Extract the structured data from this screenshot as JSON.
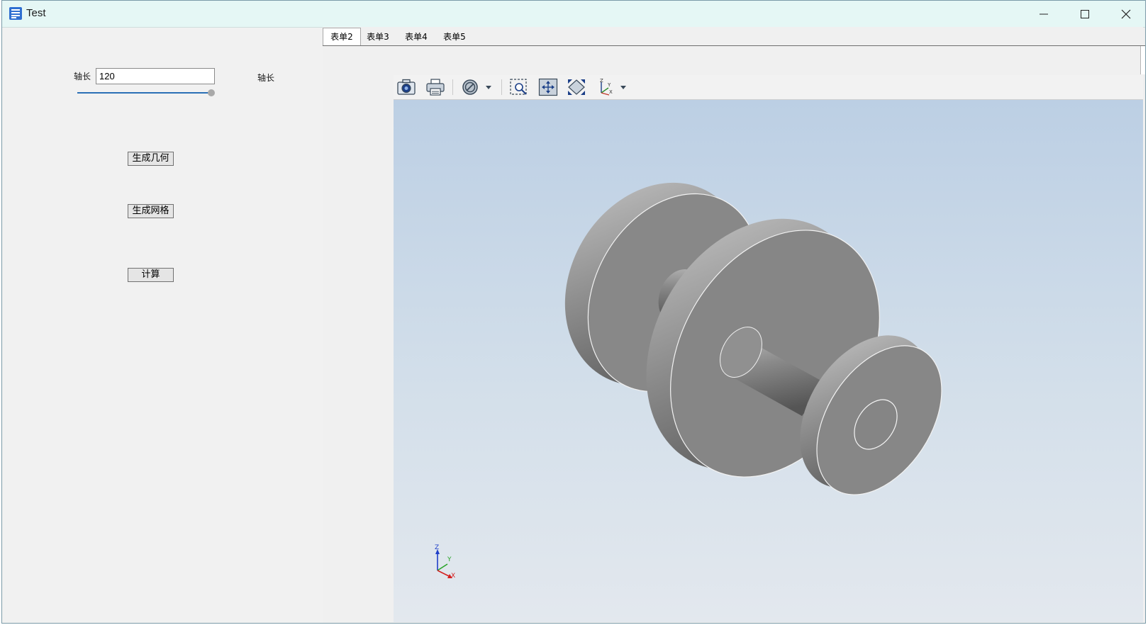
{
  "window": {
    "title": "Test"
  },
  "controls": {
    "axis_label": "轴长",
    "axis_value": "120",
    "axis_label_right": "轴长",
    "slider_value": 1.0,
    "generate_geometry": "生成几何",
    "generate_mesh": "生成网格",
    "compute": "计算"
  },
  "tabs": [
    {
      "label": "表单2",
      "active": true
    },
    {
      "label": "表单3",
      "active": false
    },
    {
      "label": "表单4",
      "active": false
    },
    {
      "label": "表单5",
      "active": false
    }
  ],
  "viewer": {
    "toolbar": [
      "camera-icon",
      "print-icon",
      "clip-plane-icon",
      "zoom-box-icon",
      "fit-all-icon",
      "zoom-extents-icon",
      "view-axes-icon"
    ],
    "triad": {
      "x": "X",
      "y": "Y",
      "z": "Z"
    }
  },
  "colors": {
    "titlebar": "#e5f7f5",
    "panel": "#f1f1f1",
    "viewport_top": "#bccfe4",
    "viewport_bottom": "#e3e8ee",
    "model": "#868686"
  }
}
